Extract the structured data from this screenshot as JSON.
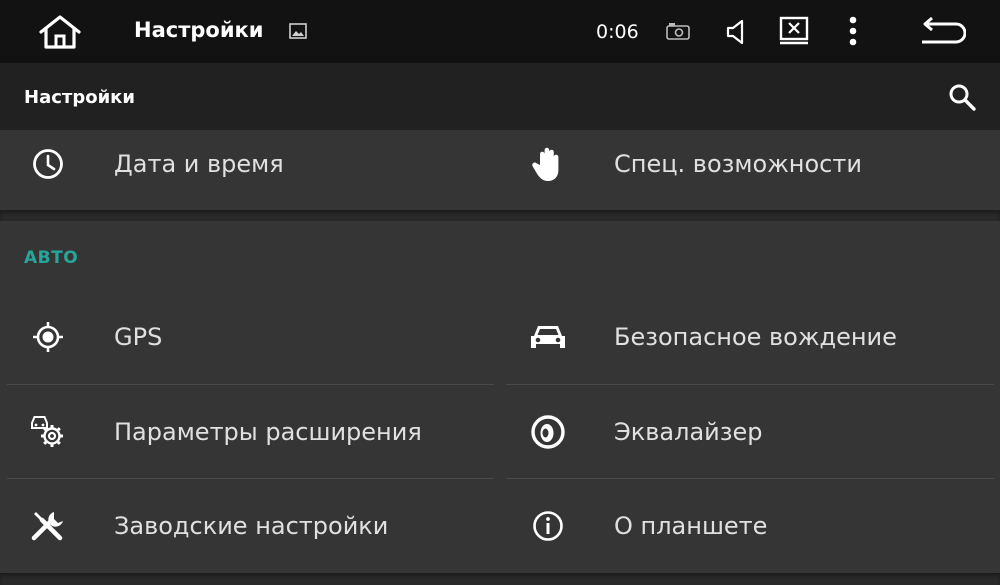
{
  "statusbar": {
    "title": "Настройки",
    "clock": "0:06"
  },
  "toolbar": {
    "title": "Настройки"
  },
  "top_items": [
    {
      "label": "Дата и время",
      "icon": "clock-icon"
    },
    {
      "label": "Спец. возможности",
      "icon": "hand-icon"
    }
  ],
  "section": {
    "title": "АВТО"
  },
  "auto_items": [
    {
      "label": "GPS",
      "icon": "gps-icon"
    },
    {
      "label": "Безопасное вождение",
      "icon": "car-icon"
    },
    {
      "label": "Параметры расширения",
      "icon": "car-settings-icon"
    },
    {
      "label": "Эквалайзер",
      "icon": "equalizer-icon"
    },
    {
      "label": "Заводские настройки",
      "icon": "tools-icon"
    },
    {
      "label": "О планшете",
      "icon": "info-icon"
    }
  ],
  "colors": {
    "accent": "#26a69a",
    "statusbar_bg": "#121212",
    "toolbar_bg": "#212121",
    "card_bg": "#353535"
  }
}
